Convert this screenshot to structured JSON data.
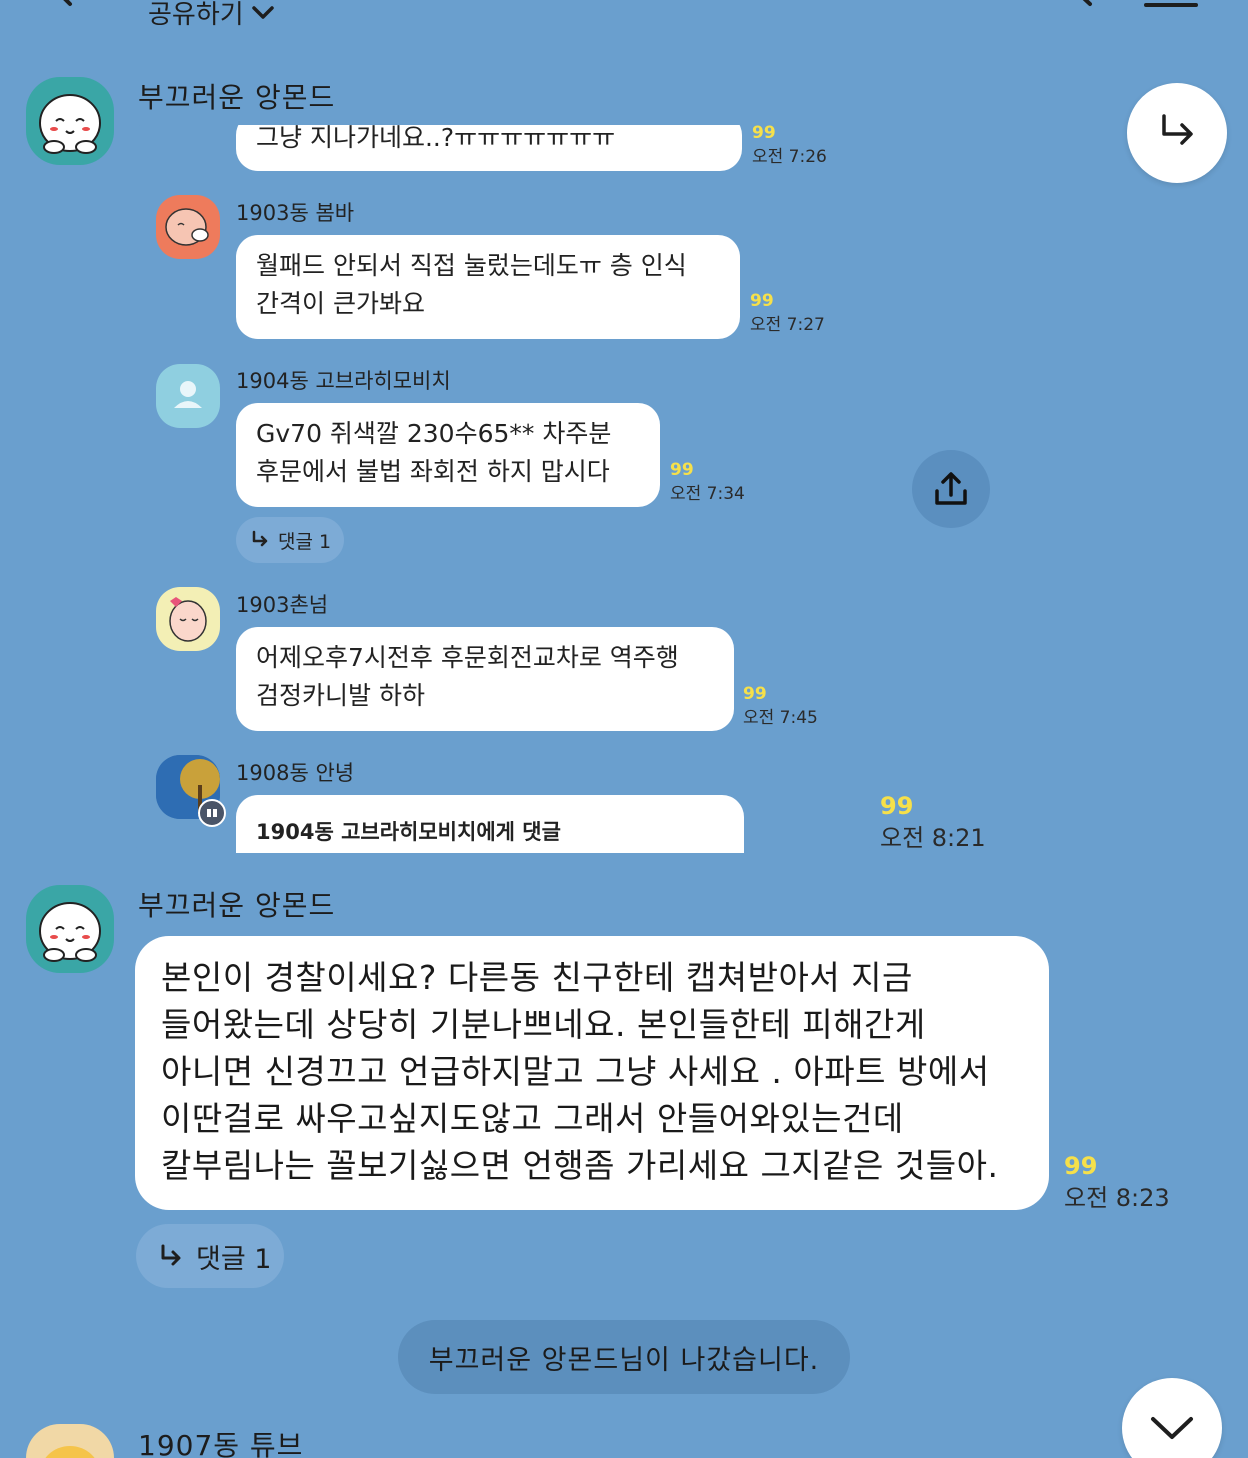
{
  "header": {
    "title": "공유하기",
    "back_icon": "chevron-left-icon",
    "search_icon": "search-icon",
    "menu_icon": "menu-icon"
  },
  "colors": {
    "background": "#6a9fce",
    "bubble": "#ffffff",
    "read_count": "#f6e04a",
    "avatar_teal": "#3aa6a6"
  },
  "post": {
    "sender": "부끄러운 앙몬드",
    "shared": {
      "messages": [
        {
          "sender": "",
          "lines": [
            "그냥 지나가네요..?ㅠㅠㅠㅠㅠㅠㅠ"
          ],
          "read": "99",
          "time": "오전 7:26"
        },
        {
          "sender": "1903동 봄바",
          "lines": [
            "월패드 안되서 직접 눌렀는데도ㅠ 층 인식",
            "간격이 큰가봐요"
          ],
          "read": "99",
          "time": "오전 7:27"
        },
        {
          "sender": "1904동 고브라히모비치",
          "lines": [
            "Gv70 쥐색깔 230수65** 차주분",
            "후문에서 불법 좌회전 하지 맙시다"
          ],
          "read": "99",
          "time": "오전 7:34",
          "reply": "댓글 1"
        },
        {
          "sender": "1903촌넘",
          "lines": [
            "어제오후7시전후 후문회전교차로 역주행",
            "검정카니발 하하"
          ],
          "read": "99",
          "time": "오전 7:45"
        },
        {
          "sender": "1908동 안녕",
          "lines": [
            "1904동 고브라히모비치에게 댓글"
          ]
        }
      ]
    },
    "read": "99",
    "time": "오전 8:21"
  },
  "reply_post": {
    "sender": "부끄러운 앙몬드",
    "lines": [
      "본인이 경찰이세요? 다른동 친구한테 캡쳐받아서 지금",
      "들어왔는데 상당히 기분나쁘네요. 본인들한테 피해간게",
      "아니면 신경끄고 언급하지말고 그냥 사세요 . 아파트 방에서",
      "이딴걸로 싸우고싶지도않고 그래서 안들어와있는건데",
      "칼부림나는 꼴보기싫으면 언행좀 가리세요 그지같은 것들아."
    ],
    "read": "99",
    "time": "오전 8:23",
    "reply": "댓글 1"
  },
  "system_message": "부끄러운 앙몬드님이 나갔습니다.",
  "next_sender": "1907동 튜브"
}
